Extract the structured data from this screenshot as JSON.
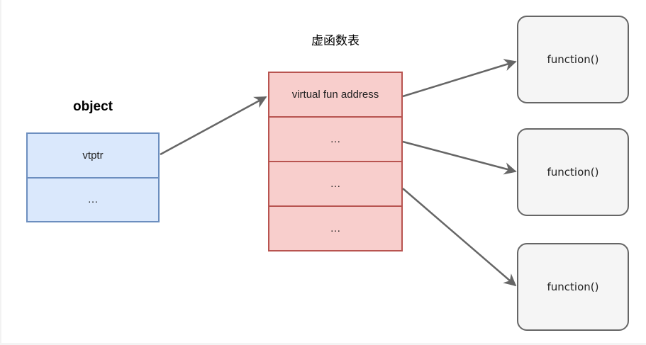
{
  "object": {
    "title": "object",
    "cells": [
      "vtptr",
      "…"
    ]
  },
  "vtable": {
    "title": "虚函数表",
    "cells": [
      "virtual fun address",
      "…",
      "…",
      "…"
    ]
  },
  "functions": [
    "function()",
    "function()",
    "function()"
  ],
  "colors": {
    "object_fill": "#dae8fc",
    "object_stroke": "#6c8ebf",
    "vtable_fill": "#f8cecc",
    "vtable_stroke": "#b85450",
    "function_fill": "#f5f5f5",
    "function_stroke": "#666666",
    "arrow": "#666666"
  }
}
